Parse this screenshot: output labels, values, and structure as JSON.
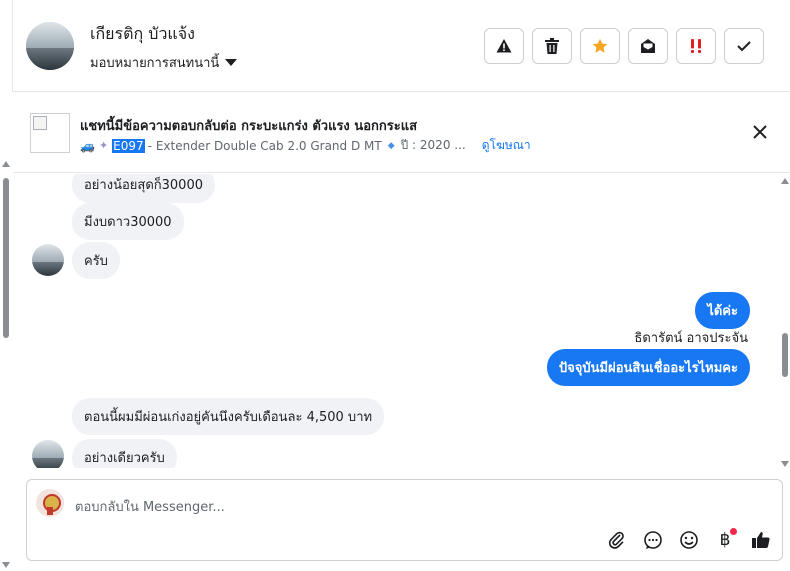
{
  "header": {
    "contact_name": "เกียรติกุ บัวแจ้ง",
    "assign_label": "มอบหมายการสนทนานี้",
    "actions": [
      {
        "name": "spam",
        "icon": "warning-icon"
      },
      {
        "name": "delete",
        "icon": "trash-icon"
      },
      {
        "name": "star",
        "icon": "star-icon",
        "color": "#f5a623"
      },
      {
        "name": "mark-unread",
        "icon": "envelope-open-icon"
      },
      {
        "name": "follow-up",
        "icon": "exclamation-icon",
        "color": "#e02020"
      },
      {
        "name": "done",
        "icon": "check-icon"
      }
    ]
  },
  "ad": {
    "title": "แชทนี้มีข้อความตอบกลับต่อ กระบะแกร่ง ตัวแรง นอกกระแส",
    "code": "E097",
    "description": "- Extender Double Cab 2.0 Grand D MT",
    "year": "ปี : 2020 ...",
    "view_link": "ดูโฆษณา"
  },
  "messages": [
    {
      "from": "contact",
      "text": "อย่างน้อยสุดก็30000"
    },
    {
      "from": "contact",
      "text": "มีงบดาว30000"
    },
    {
      "from": "contact",
      "text": "ครับ"
    },
    {
      "from": "page",
      "text": "ได้ค่ะ"
    },
    {
      "from": "page",
      "sender": "ธิดารัตน์ อาจประจัน",
      "text": "ปัจจุบันมีผ่อนสินเชื่ออะไรไหมคะ"
    },
    {
      "from": "contact",
      "text": "ตอนนี้ผมมีผ่อนเก่งอยู่คันนึงครับเดือนละ 4,500 บาท"
    },
    {
      "from": "contact",
      "text": "อย่างเดียวครับ"
    }
  ],
  "composer": {
    "placeholder": "ตอบกลับใน Messenger...",
    "tools": [
      "paperclip-icon",
      "chat-bubble-icon",
      "smiley-icon",
      "baht-icon",
      "thumbs-up-icon"
    ]
  },
  "colors": {
    "accent": "#1877f2",
    "bubble_in": "#f0f2f5",
    "star": "#f5a623",
    "alert": "#e02020"
  }
}
